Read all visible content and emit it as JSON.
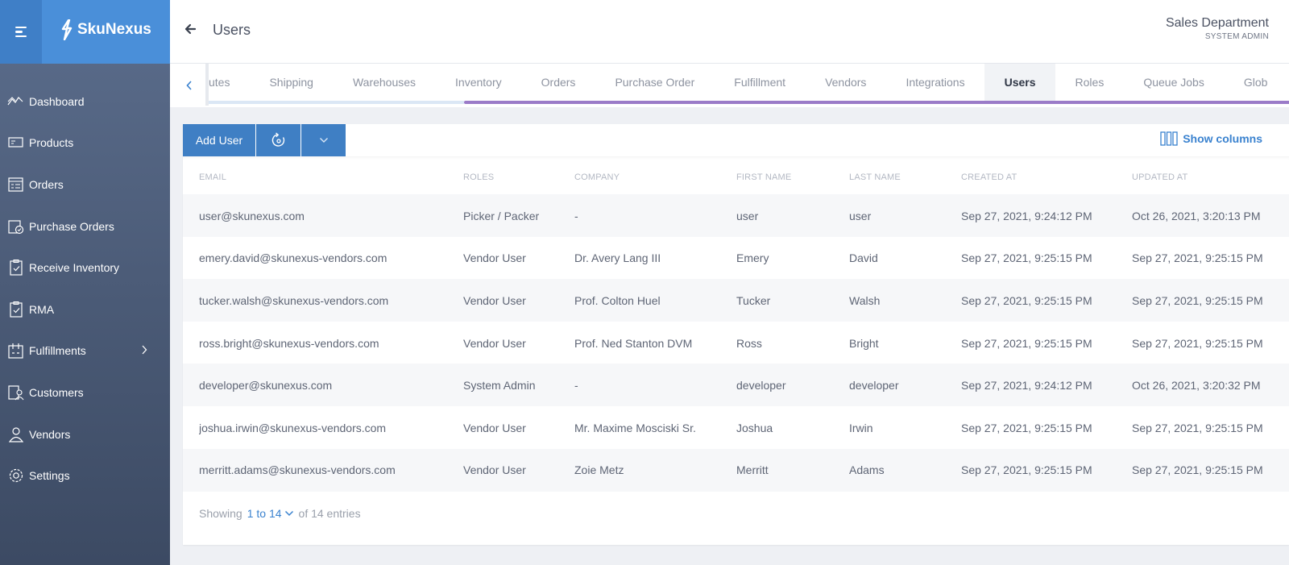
{
  "app": {
    "brand": "SkuNexus",
    "colors": {
      "sidebar_top": "#4a8fd9",
      "sidebar": "#3c4a63",
      "accent": "#3f7fc4",
      "tab_indicator": "#9a7bc8"
    }
  },
  "sidebar": {
    "items": [
      {
        "label": "Dashboard",
        "icon": "dashboard-icon"
      },
      {
        "label": "Products",
        "icon": "products-icon"
      },
      {
        "label": "Orders",
        "icon": "orders-icon"
      },
      {
        "label": "Purchase Orders",
        "icon": "purchase-orders-icon"
      },
      {
        "label": "Receive Inventory",
        "icon": "clipboard-check-icon"
      },
      {
        "label": "RMA",
        "icon": "clipboard-check-icon"
      },
      {
        "label": "Fulfillments",
        "icon": "fulfillments-icon",
        "has_children": true
      },
      {
        "label": "Customers",
        "icon": "customers-icon"
      },
      {
        "label": "Vendors",
        "icon": "vendors-icon"
      },
      {
        "label": "Settings",
        "icon": "gear-icon"
      }
    ]
  },
  "header": {
    "title": "Users",
    "org_name": "Sales Department",
    "org_role": "SYSTEM ADMIN"
  },
  "tabs": {
    "items": [
      "utes",
      "Shipping",
      "Warehouses",
      "Inventory",
      "Orders",
      "Purchase Order",
      "Fulfillment",
      "Vendors",
      "Integrations",
      "Users",
      "Roles",
      "Queue Jobs",
      "Glob"
    ],
    "active": "Users"
  },
  "toolbar": {
    "add_label": "Add User",
    "show_columns_label": "Show columns"
  },
  "table": {
    "columns": [
      "Email",
      "Roles",
      "Company",
      "First Name",
      "Last Name",
      "Created At",
      "Updated At"
    ],
    "rows": [
      [
        "user@skunexus.com",
        "Picker / Packer",
        "-",
        "user",
        "user",
        "Sep 27, 2021, 9:24:12 PM",
        "Oct 26, 2021, 3:20:13 PM"
      ],
      [
        "emery.david@skunexus-vendors.com",
        "Vendor User",
        "Dr. Avery Lang III",
        "Emery",
        "David",
        "Sep 27, 2021, 9:25:15 PM",
        "Sep 27, 2021, 9:25:15 PM"
      ],
      [
        "tucker.walsh@skunexus-vendors.com",
        "Vendor User",
        "Prof. Colton Huel",
        "Tucker",
        "Walsh",
        "Sep 27, 2021, 9:25:15 PM",
        "Sep 27, 2021, 9:25:15 PM"
      ],
      [
        "ross.bright@skunexus-vendors.com",
        "Vendor User",
        "Prof. Ned Stanton DVM",
        "Ross",
        "Bright",
        "Sep 27, 2021, 9:25:15 PM",
        "Sep 27, 2021, 9:25:15 PM"
      ],
      [
        "developer@skunexus.com",
        "System Admin",
        "-",
        "developer",
        "developer",
        "Sep 27, 2021, 9:24:12 PM",
        "Oct 26, 2021, 3:20:32 PM"
      ],
      [
        "joshua.irwin@skunexus-vendors.com",
        "Vendor User",
        "Mr. Maxime Mosciski Sr.",
        "Joshua",
        "Irwin",
        "Sep 27, 2021, 9:25:15 PM",
        "Sep 27, 2021, 9:25:15 PM"
      ],
      [
        "merritt.adams@skunexus-vendors.com",
        "Vendor User",
        "Zoie Metz",
        "Merritt",
        "Adams",
        "Sep 27, 2021, 9:25:15 PM",
        "Sep 27, 2021, 9:25:15 PM"
      ]
    ]
  },
  "footer": {
    "prefix": "Showing",
    "page_range": "1 to 14",
    "suffix": "of 14 entries"
  }
}
